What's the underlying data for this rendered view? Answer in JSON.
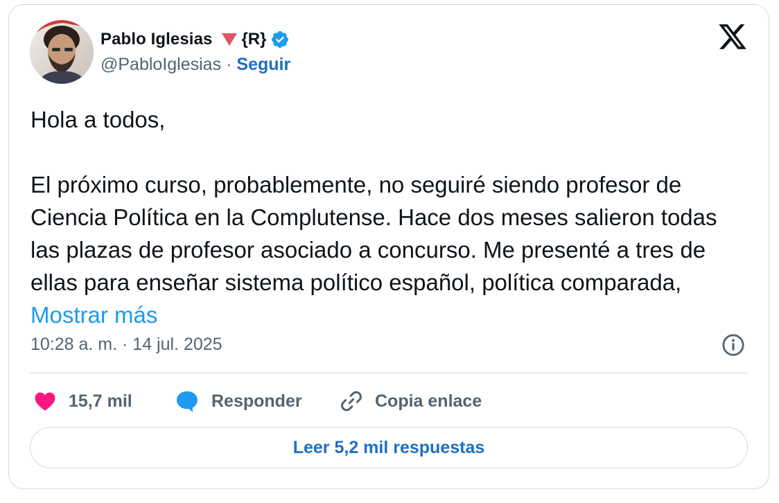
{
  "author": {
    "name": "Pablo Iglesias",
    "tag": "{R}",
    "handle": "@PabloIglesias",
    "separator": "·",
    "follow_label": "Seguir"
  },
  "tweet": {
    "greeting": "Hola a todos,",
    "body": "El próximo curso, probablemente, no seguiré siendo profesor de Ciencia Política en la Complutense. Hace dos meses salieron todas las plazas de profesor asociado a concurso. Me presenté a tres de ellas para enseñar sistema político español, política comparada, ",
    "show_more": "Mostrar más",
    "timestamp": "10:28 a. m. · 14 jul. 2025"
  },
  "actions": {
    "likes": "15,7 mil",
    "reply": "Responder",
    "copy_link": "Copia enlace"
  },
  "read_replies": "Leer 5,2 mil respuestas",
  "icons": {
    "logo": "x-logo-icon",
    "verified": "verified-badge-icon",
    "info": "info-icon",
    "like": "heart-icon",
    "reply": "speech-bubble-icon",
    "link": "link-icon"
  },
  "colors": {
    "accent_blue": "#1d9bf0",
    "link_blue": "#1d6fc4",
    "heart_pink": "#f91880",
    "muted_gray": "#536471",
    "triangle_red": "#e25463",
    "border": "#cfd9de"
  }
}
